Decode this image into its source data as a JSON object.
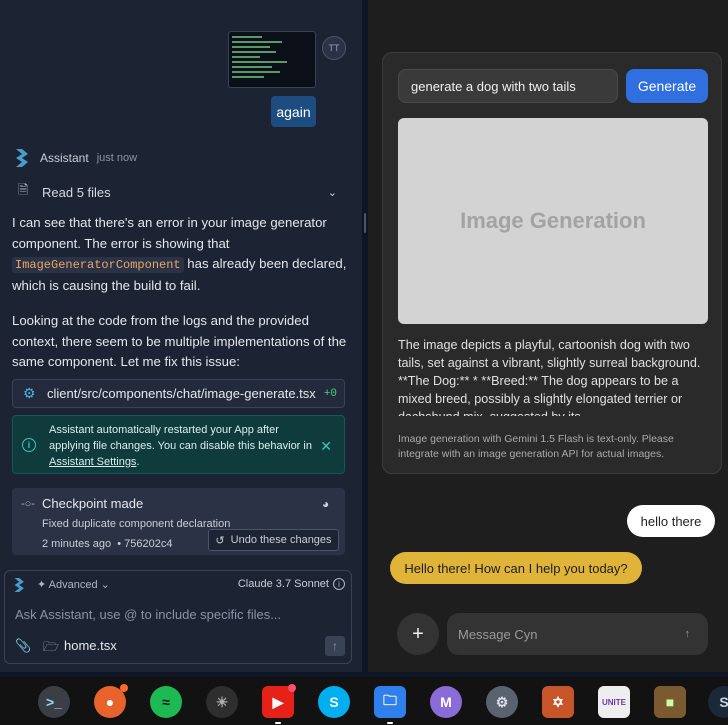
{
  "left": {
    "user_avatar": "TT",
    "user_message": "again",
    "assistant": {
      "name": "Assistant",
      "time": "just now"
    },
    "read_files": "Read 5 files",
    "para1_a": "I can see that there's an error in your image generator component. The error is showing that ",
    "para1_code": "ImageGeneratorComponent",
    "para1_b": " has already been declared, which is causing the build to fail.",
    "para2": "Looking at the code from the logs and the provided context, there seem to be multiple implementations of the same component. Let me fix this issue:",
    "file_path": "client/src/components/chat/image-generate.tsx",
    "file_diff": "+0",
    "info_text": "Assistant automatically restarted your App after applying file changes. You can disable this behavior in ",
    "info_link": "Assistant Settings",
    "info_end": ".",
    "checkpoint": {
      "title": "Checkpoint made",
      "desc": "Fixed duplicate component declaration",
      "time": "2 minutes ago",
      "hash": "• 756202c4",
      "undo": "Undo these changes"
    },
    "composer": {
      "advanced": "Advanced",
      "model": "Claude 3.7 Sonnet",
      "placeholder": "Ask Assistant, use @ to include specific files...",
      "file": "home.tsx"
    }
  },
  "right": {
    "prompt_value": "generate a dog with two tails",
    "generate_label": "Generate",
    "image_placeholder": "Image Generation",
    "description": "The image depicts a playful, cartoonish dog with two tails, set against a vibrant, slightly surreal background. **The Dog:** * **Breed:** The dog appears to be a mixed breed, possibly a slightly elongated terrier or dachshund mix, suggested by its",
    "note": "Image generation with Gemini 1.5 Flash is text-only. Please integrate with an image generation API for actual images.",
    "user_bubble": "hello there",
    "bot_bubble": "Hello there! How can I help you today?",
    "message_placeholder": "Message Cyn"
  },
  "taskbar": {
    "apps": [
      "terminal-icon",
      "firefox-icon",
      "spotify-icon",
      "gimp-icon",
      "youtube-icon",
      "skype-icon",
      "files-icon",
      "mail-icon",
      "settings-icon",
      "tf2-icon",
      "unite-icon",
      "minecraft-icon",
      "steam-icon"
    ]
  }
}
